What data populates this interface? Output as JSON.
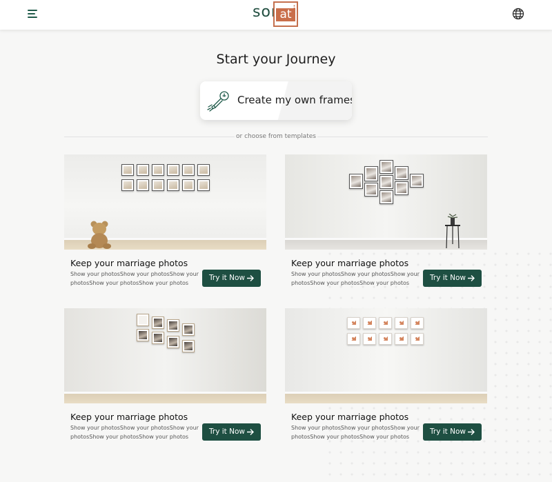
{
  "header": {
    "menu_icon": "menu-icon",
    "logo_text": "sor",
    "logo_box_text": "at",
    "logo_suffix": "i",
    "language_icon": "globe-icon"
  },
  "main": {
    "title": "Start your Journey",
    "create_button": {
      "label": "Create my own frames",
      "icon": "rocket-bulb-icon"
    },
    "divider_text": "or choose from templates"
  },
  "cards": [
    {
      "heading": "Keep your marriage photos",
      "description": "Show your photosShow your photosShow your photosShow your photosShow your photos",
      "button": "Try it Now"
    },
    {
      "heading": "Keep your marriage photos",
      "description": "Show your photosShow your photosShow your photosShow your photosShow your photos",
      "button": "Try it Now"
    },
    {
      "heading": "Keep your marriage photos",
      "description": "Show your photosShow your photosShow your photosShow your photosShow your photos",
      "button": "Try it Now"
    },
    {
      "heading": "Keep your marriage photos",
      "description": "Show your photosShow your photosShow your photosShow your photosShow your photos",
      "button": "Try it Now"
    }
  ],
  "colors": {
    "brand_green": "#1e4f42",
    "brand_orange": "#c96e4a",
    "background": "#f7f7f6"
  }
}
